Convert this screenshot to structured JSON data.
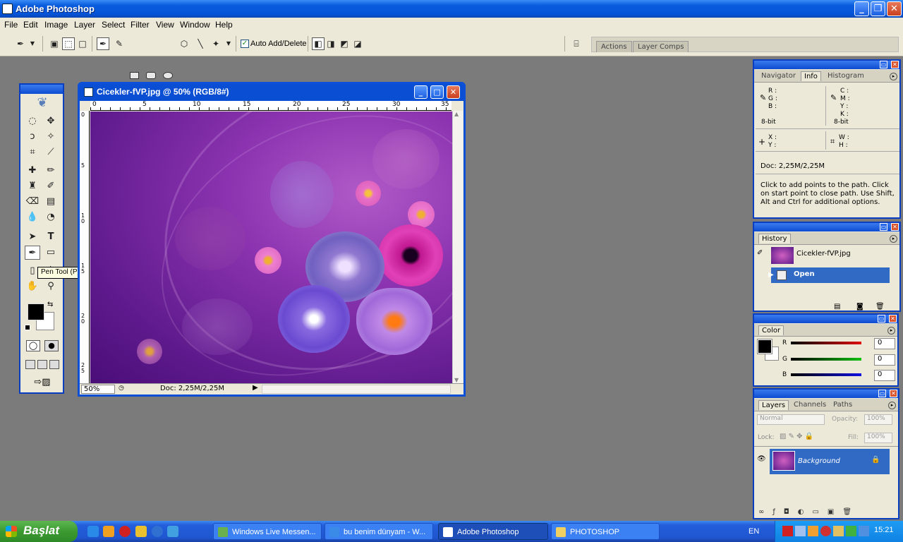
{
  "app": {
    "title": "Adobe Photoshop"
  },
  "menu": [
    "File",
    "Edit",
    "Image",
    "Layer",
    "Select",
    "Filter",
    "View",
    "Window",
    "Help"
  ],
  "options": {
    "auto_add_delete_label": "Auto Add/Delete",
    "auto_add_delete_checked": true
  },
  "palette_well": {
    "tabs": [
      "Actions",
      "Layer Comps"
    ]
  },
  "tooltip": "Pen Tool (P)",
  "document": {
    "title": "Cicekler-fVP.jpg @ 50% (RGB/8#)",
    "hruler_ticks": [
      "0",
      "5",
      "10",
      "15",
      "20",
      "25",
      "30",
      "35"
    ],
    "vruler_ticks": [
      "0",
      "5",
      "1\n0",
      "1\n5",
      "2\n0",
      "2\n5"
    ],
    "zoom": "50%",
    "status": "Doc: 2,25M/2,25M"
  },
  "info_panel": {
    "tabs": [
      "Navigator",
      "Info",
      "Histogram"
    ],
    "active_tab": "Info",
    "rgb_labels": [
      "R :",
      "G :",
      "B :"
    ],
    "cmyk_labels": [
      "C :",
      "M :",
      "Y :",
      "K :"
    ],
    "bit_left": "8-bit",
    "bit_right": "8-bit",
    "xy_labels": [
      "X :",
      "Y :"
    ],
    "wh_labels": [
      "W :",
      "H :"
    ],
    "doc": "Doc: 2,25M/2,25M",
    "hint": "Click to add points to the path.  Click on start point to close path.  Use Shift, Alt and Ctrl for additional options."
  },
  "history_panel": {
    "tab": "History",
    "snapshot": "Cicekler-fVP.jpg",
    "step": "Open"
  },
  "color_panel": {
    "tab": "Color",
    "channels": [
      {
        "label": "R",
        "value": "0",
        "color": "#e01010"
      },
      {
        "label": "G",
        "value": "0",
        "color": "#10c010"
      },
      {
        "label": "B",
        "value": "0",
        "color": "#1010e0"
      }
    ]
  },
  "layers_panel": {
    "tabs": [
      "Layers",
      "Channels",
      "Paths"
    ],
    "blend": "Normal",
    "opacity_label": "Opacity:",
    "opacity": "100%",
    "lock_label": "Lock:",
    "fill_label": "Fill:",
    "fill": "100%",
    "layer": "Background"
  },
  "taskbar": {
    "start": "Başlat",
    "tasks": [
      "Windows Live Messen...",
      "bu benim dünyam - W...",
      "Adobe Photoshop",
      "PHOTOSHOP"
    ],
    "lang": "EN",
    "clock": "15:21"
  }
}
